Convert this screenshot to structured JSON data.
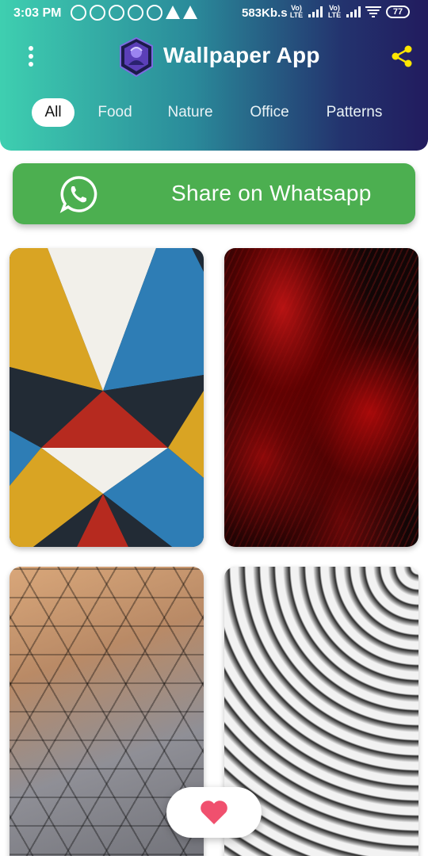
{
  "status_bar": {
    "time": "3:03 PM",
    "net_speed": "583Kb.s",
    "sim1_label": "Vo) LTE",
    "sim2_label": "Vo) LTE",
    "battery": "77"
  },
  "header": {
    "title": "Wallpaper App",
    "menu_icon": "more-vert-icon",
    "share_icon": "share-icon",
    "gradient_start": "#3ecfb0",
    "gradient_end": "#221b5e"
  },
  "tabs": [
    {
      "label": "All",
      "active": true
    },
    {
      "label": "Food",
      "active": false
    },
    {
      "label": "Nature",
      "active": false
    },
    {
      "label": "Office",
      "active": false
    },
    {
      "label": "Patterns",
      "active": false
    }
  ],
  "whatsapp_button": {
    "label": "Share on Whatsapp",
    "icon": "whatsapp-icon",
    "color": "#4caf50"
  },
  "wallpapers": [
    {
      "name": "geometric-triangles"
    },
    {
      "name": "red-fractal"
    },
    {
      "name": "metallic-facets"
    },
    {
      "name": "white-architecture"
    }
  ],
  "favorite_button": {
    "icon": "heart-icon",
    "color": "#f0506e"
  }
}
